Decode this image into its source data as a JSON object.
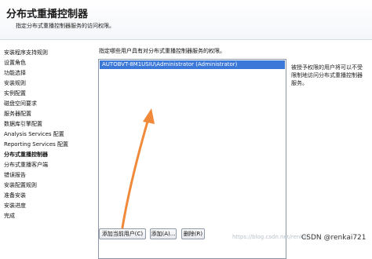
{
  "header": {
    "title": "分布式重播控制器",
    "subtitle": "指定分布式重播控制器服务的访问权限。"
  },
  "sidebar": {
    "items": [
      {
        "label": "安装程序支持规则"
      },
      {
        "label": "设置角色"
      },
      {
        "label": "功能选择"
      },
      {
        "label": "安装规则"
      },
      {
        "label": "实例配置"
      },
      {
        "label": "磁盘空间要求"
      },
      {
        "label": "服务器配置"
      },
      {
        "label": "数据库引擎配置"
      },
      {
        "label": "Analysis Services 配置"
      },
      {
        "label": "Reporting Services 配置"
      },
      {
        "label": "分布式重播控制器"
      },
      {
        "label": "分布式重播客户端"
      },
      {
        "label": "错误报告"
      },
      {
        "label": "安装配置规则"
      },
      {
        "label": "准备安装"
      },
      {
        "label": "安装进度"
      },
      {
        "label": "完成"
      }
    ],
    "active_index": 10
  },
  "main": {
    "instruction": "指定哪些用户具有对分布式重播控制器服务的权限。",
    "users": [
      "AUTOBVT-8M1USIU\\Administrator (Administrator)"
    ],
    "help_text": "被授予权限的用户将可以不受限制地访问分布式重播控制器服务。",
    "buttons": {
      "add_current_user": "添加当前用户(C)",
      "add": "添加(A)...",
      "remove": "删除(R)"
    }
  },
  "watermark": "https://blog.csdn.net/renkai",
  "credit": "CSDN @renkai721"
}
